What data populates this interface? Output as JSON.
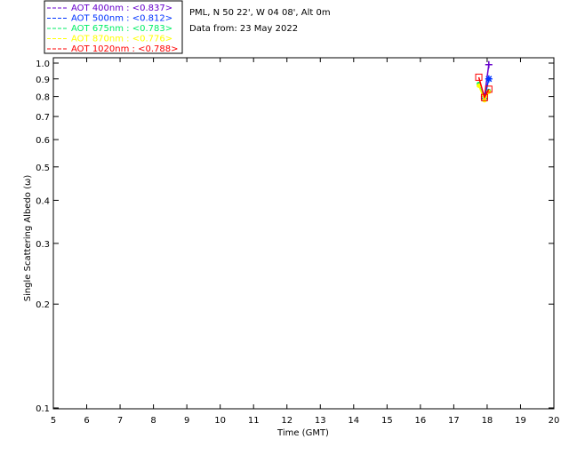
{
  "header": {
    "site": "PML, N 50 22', W 04 08', Alt 0m",
    "date": "Data from: 23 May 2022"
  },
  "chart_data": {
    "type": "scatter",
    "xlabel": "Time (GMT)",
    "ylabel": "Single Scattering Albedo (ω)",
    "xlim": [
      5,
      20
    ],
    "ylim": [
      0.1,
      1.0
    ],
    "yscale": "log",
    "xticks": [
      "5",
      "6",
      "7",
      "8",
      "9",
      "10",
      "11",
      "12",
      "13",
      "14",
      "15",
      "16",
      "17",
      "18",
      "19",
      "20"
    ],
    "yticks": [
      {
        "v": 0.1,
        "label": "0.1"
      },
      {
        "v": 0.2,
        "label": "0.2"
      },
      {
        "v": 0.3,
        "label": "0.3"
      },
      {
        "v": 0.4,
        "label": "0.4"
      },
      {
        "v": 0.5,
        "label": "0.5"
      },
      {
        "v": 0.6,
        "label": "0.6"
      },
      {
        "v": 0.7,
        "label": "0.7"
      },
      {
        "v": 0.8,
        "label": "0.8"
      },
      {
        "v": 0.9,
        "label": "0.9"
      },
      {
        "v": 1.0,
        "label": "1.0"
      }
    ],
    "grid": false,
    "legend_position": "top-left",
    "series": [
      {
        "name": "AOT  400nm : <0.837>",
        "color": "#6600cc",
        "marker": "plus",
        "x": [
          17.92,
          18.05
        ],
        "y": [
          0.8,
          0.99
        ]
      },
      {
        "name": "AOT  500nm : <0.812>",
        "color": "#0033ff",
        "marker": "star",
        "x": [
          17.92,
          18.05
        ],
        "y": [
          0.79,
          0.9
        ]
      },
      {
        "name": "AOT  675nm : <0.783>",
        "color": "#00ee66",
        "marker": "dot",
        "x": [
          17.75,
          17.92,
          18.05
        ],
        "y": [
          0.87,
          0.785,
          0.83
        ]
      },
      {
        "name": "AOT  870nm : <0.776>",
        "color": "#ffff00",
        "marker": "dot",
        "x": [
          17.75,
          17.92,
          18.05
        ],
        "y": [
          0.86,
          0.78,
          0.825
        ]
      },
      {
        "name": "AOT 1020nm : <0.788>",
        "color": "#ff0000",
        "marker": "square",
        "x": [
          17.75,
          17.92,
          18.05
        ],
        "y": [
          0.91,
          0.795,
          0.84
        ]
      }
    ]
  }
}
